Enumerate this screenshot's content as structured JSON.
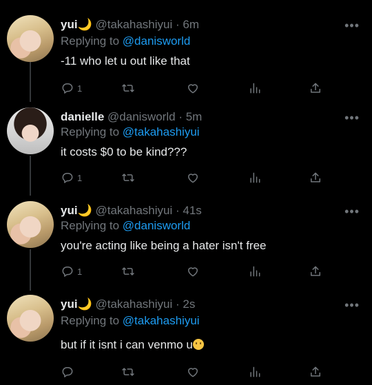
{
  "tweets": [
    {
      "name": "yui",
      "name_suffix": "🌙",
      "handle": "@takahashiyui",
      "sep": "·",
      "time": "6m",
      "replying_prefix": "Replying to",
      "replying_to": "@danisworld",
      "text": "-11 who let u out like that",
      "reply_count": "1",
      "avatar": "blonde"
    },
    {
      "name": "danielle",
      "name_suffix": "",
      "handle": "@danisworld",
      "sep": "·",
      "time": "5m",
      "replying_prefix": "Replying to",
      "replying_to": "@takahashiyui",
      "text": "it costs $0 to be kind???",
      "reply_count": "1",
      "avatar": "dark"
    },
    {
      "name": "yui",
      "name_suffix": "🌙",
      "handle": "@takahashiyui",
      "sep": "·",
      "time": "41s",
      "replying_prefix": "Replying to",
      "replying_to": "@danisworld",
      "text": "you're acting like being a hater isn't free",
      "reply_count": "1",
      "avatar": "blonde"
    },
    {
      "name": "yui",
      "name_suffix": "🌙",
      "handle": "@takahashiyui",
      "sep": "·",
      "time": "2s",
      "replying_prefix": "Replying to",
      "replying_to": "@takahashiyui",
      "text": "but if it isnt i can venmo u",
      "reply_count": "",
      "avatar": "blonde"
    }
  ],
  "more_label": "•••",
  "icons": [
    "reply-icon",
    "retweet-icon",
    "like-icon",
    "views-icon",
    "share-icon"
  ],
  "colors": {
    "background": "#000000",
    "mention": "#1d9bf0",
    "muted": "#71767b",
    "text": "#e7e9ea"
  }
}
